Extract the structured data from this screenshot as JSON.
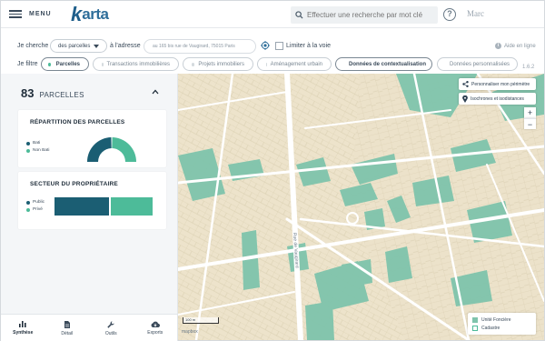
{
  "header": {
    "menu_label": "MENU",
    "logo_k": "k",
    "logo_rest": "arta",
    "search_placeholder": "Effectuer une recherche par mot clé",
    "help_icon_text": "?",
    "user_name": "Marc"
  },
  "search_bar": {
    "je_cherche_label": "Je cherche",
    "type_select": "des parcelles",
    "a_adresse_label": "à l'adresse",
    "address_value": "au 165 bis rue de Vaugirard, 75015 Paris",
    "limiter_label": "Limiter à la voie",
    "aide_label": "Aide en ligne"
  },
  "filters": {
    "label": "Je filtre",
    "items": [
      "Parcelles",
      "Transactions immobilières",
      "Projets immobiliers",
      "Aménagement urbain",
      "Données de contextualisation",
      "Données personnalisées"
    ],
    "version": "1.6.2"
  },
  "sidebar": {
    "count": "83",
    "count_label": "PARCELLES",
    "repartition": {
      "title": "RÉPARTITION DES PARCELLES",
      "legend": [
        {
          "label": "Bati",
          "color": "#1b5e73"
        },
        {
          "label": "Non Bati",
          "color": "#4dbb99"
        }
      ],
      "bati_share": 0.5
    },
    "secteur": {
      "title": "SECTEUR DU PROPRIÉTAIRE",
      "legend": [
        {
          "label": "Public",
          "color": "#1b5e73"
        },
        {
          "label": "Privé",
          "color": "#4dbb99"
        }
      ],
      "public_share": 0.56
    },
    "tabs": [
      {
        "label": "Synthèse",
        "icon": "bar-chart-icon"
      },
      {
        "label": "Détail",
        "icon": "document-icon"
      },
      {
        "label": "Outils",
        "icon": "wrench-icon"
      },
      {
        "label": "Exports",
        "icon": "cloud-download-icon"
      }
    ]
  },
  "map": {
    "perimeter_button": "Personnaliser mon périmètre",
    "isochrones_button": "Isochrones et isodistances",
    "zoom_in": "+",
    "zoom_out": "−",
    "scale_label": "100 m",
    "attribution": "mapbox",
    "street_label": "Rue de Vaugirard",
    "legend": [
      {
        "label": "Unité Foncière",
        "color": "#7fc4ac"
      },
      {
        "label": "Cadastre",
        "color": "#ffffff"
      }
    ]
  }
}
